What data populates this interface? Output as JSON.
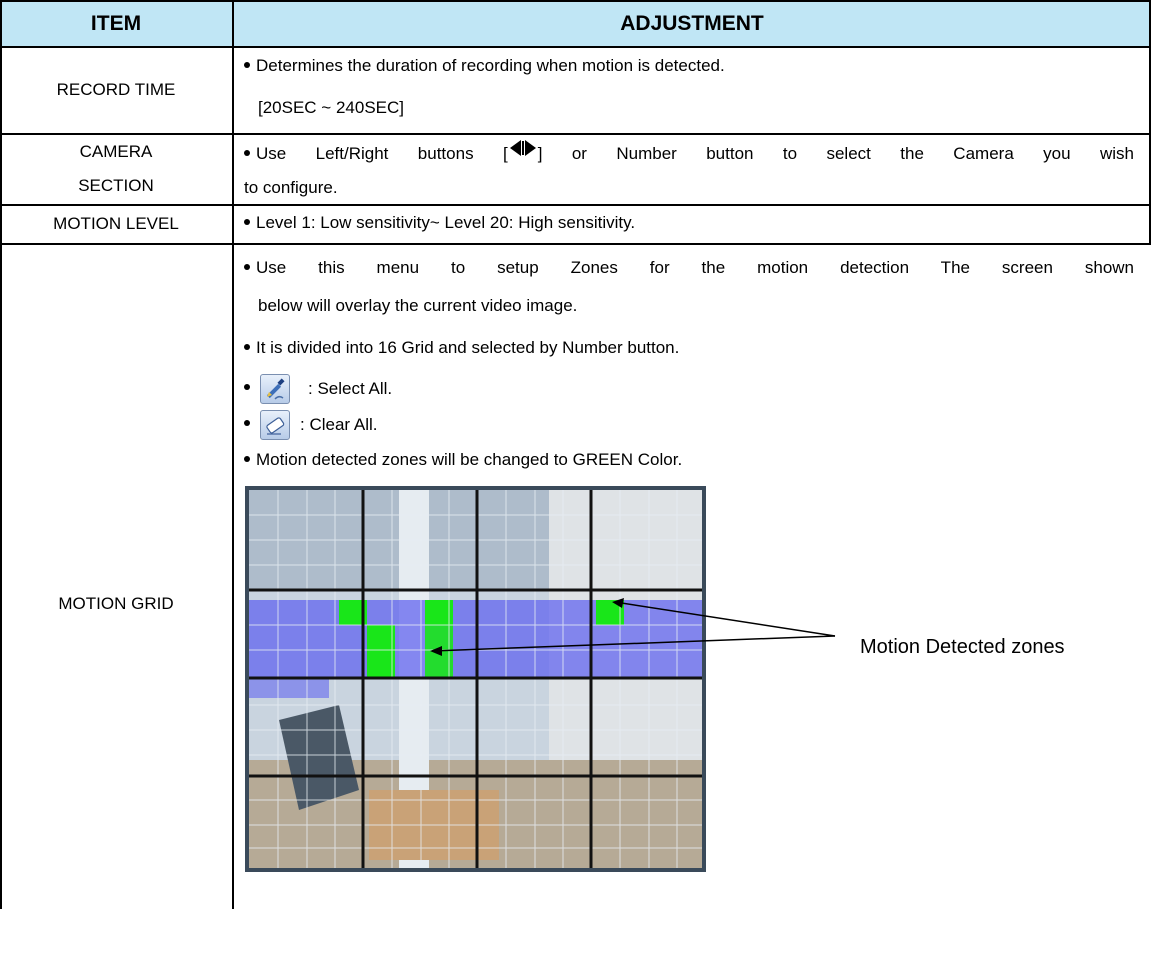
{
  "header": {
    "item": "ITEM",
    "adjustment": "ADJUSTMENT"
  },
  "rows": {
    "record_time": {
      "item": "RECORD TIME",
      "line1": "Determines the duration of recording when motion is detected.",
      "line2": "[20SEC ~ 240SEC]"
    },
    "camera_section": {
      "item_line1": "CAMERA",
      "item_line2": "SECTION",
      "line1_a": "Use Left/Right buttons [",
      "line1_b": "] or Number button to select the Camera you wish",
      "line2": "to configure."
    },
    "motion_level": {
      "item": "MOTION LEVEL",
      "line1": "Level 1: Low sensitivity~ Level 20: High sensitivity."
    },
    "motion_grid": {
      "item": "MOTION GRID",
      "bullet1_line1": "Use this menu to setup Zones for the motion detection The screen shown",
      "bullet1_line2": "below will overlay the current video image.",
      "bullet2": "It is divided into 16 Grid and selected by Number button.",
      "select_all": ": Select All.",
      "clear_all": ": Clear All.",
      "bullet5": "Motion detected zones will be changed to GREEN Color.",
      "callout": "Motion Detected zones"
    }
  },
  "icons": {
    "select_all_icon": "pencil-edit-icon",
    "clear_all_icon": "eraser-icon",
    "left_right_icon": "left-right-arrows-icon"
  },
  "colors": {
    "header_bg": "#c0e6f5",
    "detected_zone": "#19e619",
    "overlay_blue": "#5a5cf0"
  }
}
